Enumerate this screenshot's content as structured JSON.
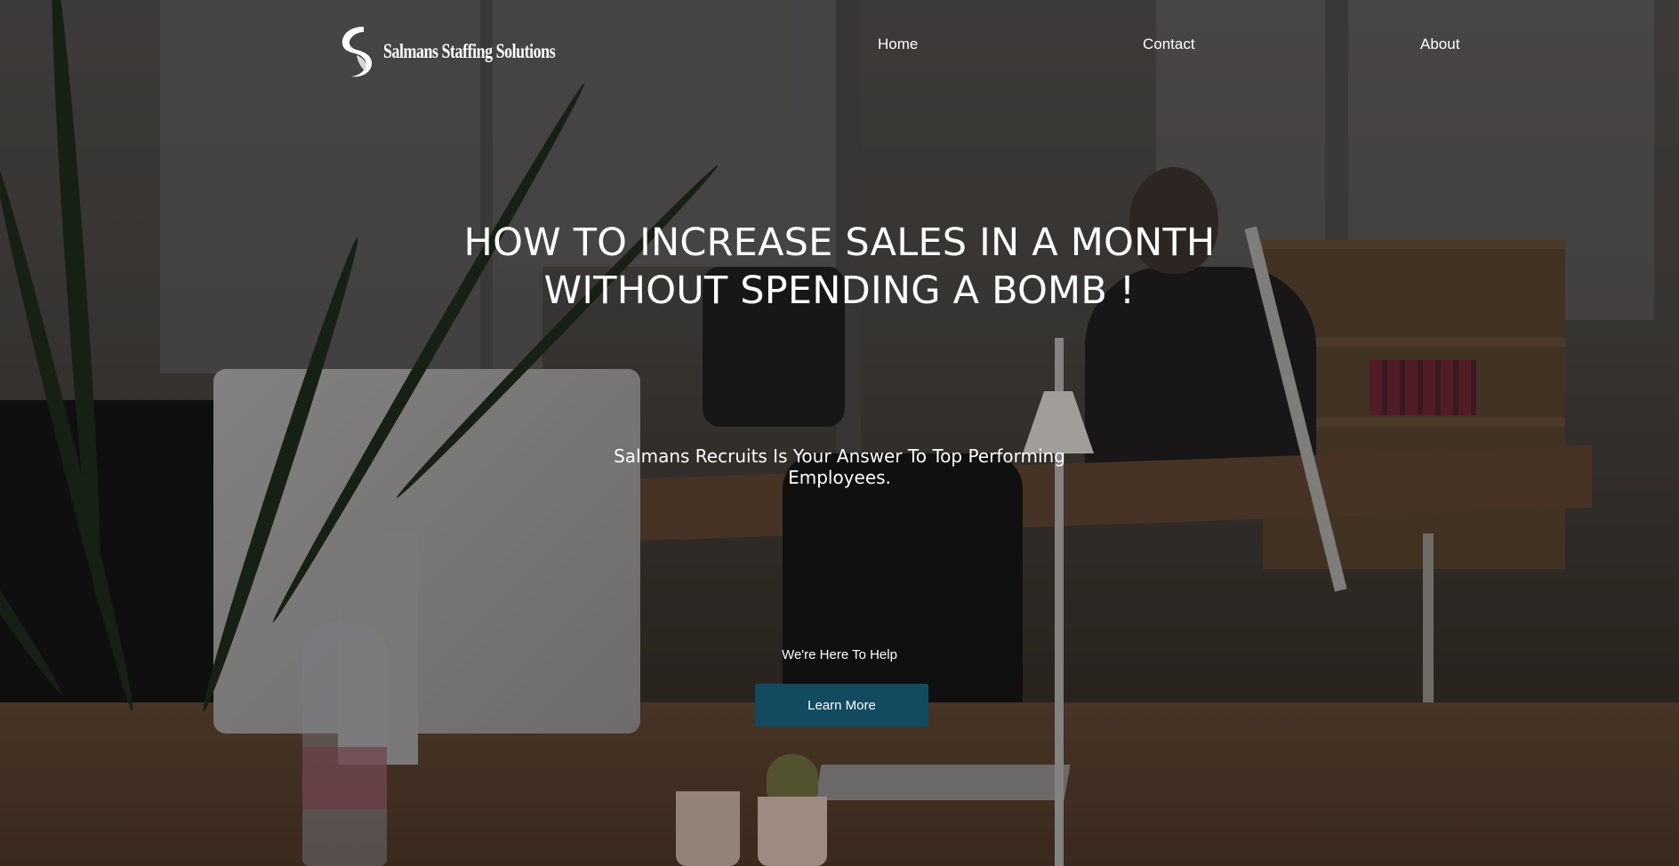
{
  "header": {
    "logo_text": "Salmans Staffing Solutions",
    "logo_icon": "stylized-s-leaf-icon",
    "nav": {
      "home": "Home",
      "contact": "Contact",
      "about": "About"
    }
  },
  "hero": {
    "title_line1": "HOW TO INCREASE SALES IN A MONTH",
    "title_line2": "WITHOUT SPENDING A BOMB !",
    "subtitle": "Salmans Recruits Is Your Answer To Top Performing Employees.",
    "help_text": "We're Here To Help",
    "cta_label": "Learn More"
  },
  "colors": {
    "text": "#ffffff",
    "cta_background": "#124a60",
    "overlay": "#000000"
  }
}
